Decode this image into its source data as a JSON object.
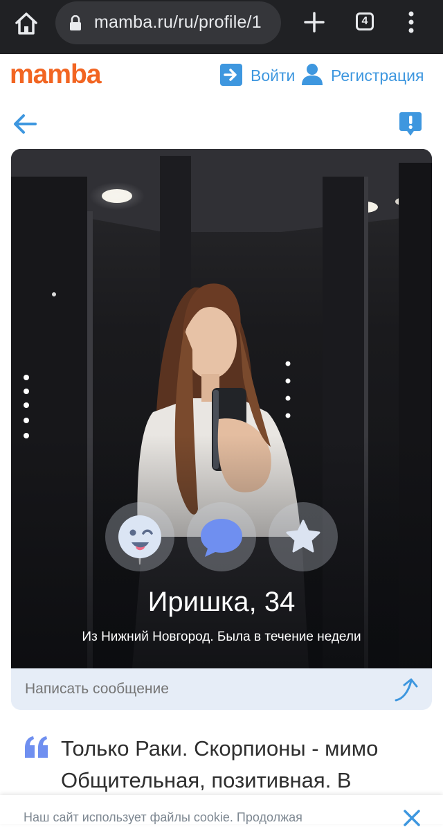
{
  "browser": {
    "url": "mamba.ru/ru/profile/1",
    "tab_count": "4"
  },
  "header": {
    "logo": "mamba",
    "login_label": "Войти",
    "register_label": "Регистрация"
  },
  "profile": {
    "name_age": "Иришка, 34",
    "meta": "Из Нижний Новгород. Была в течение недели",
    "actions": [
      "wink-icon",
      "chat-bubble-icon",
      "star-icon"
    ]
  },
  "message": {
    "placeholder": "Написать сообщение"
  },
  "about": {
    "line1": "Только Раки. Скорпионы - мимо",
    "line2": "Общительная, позитивная. В"
  },
  "cookie": {
    "text": "Наш сайт использует файлы cookie. Продолжая"
  },
  "colors": {
    "brand": "#f26522",
    "link": "#3e97df",
    "chrome": "#202124"
  }
}
